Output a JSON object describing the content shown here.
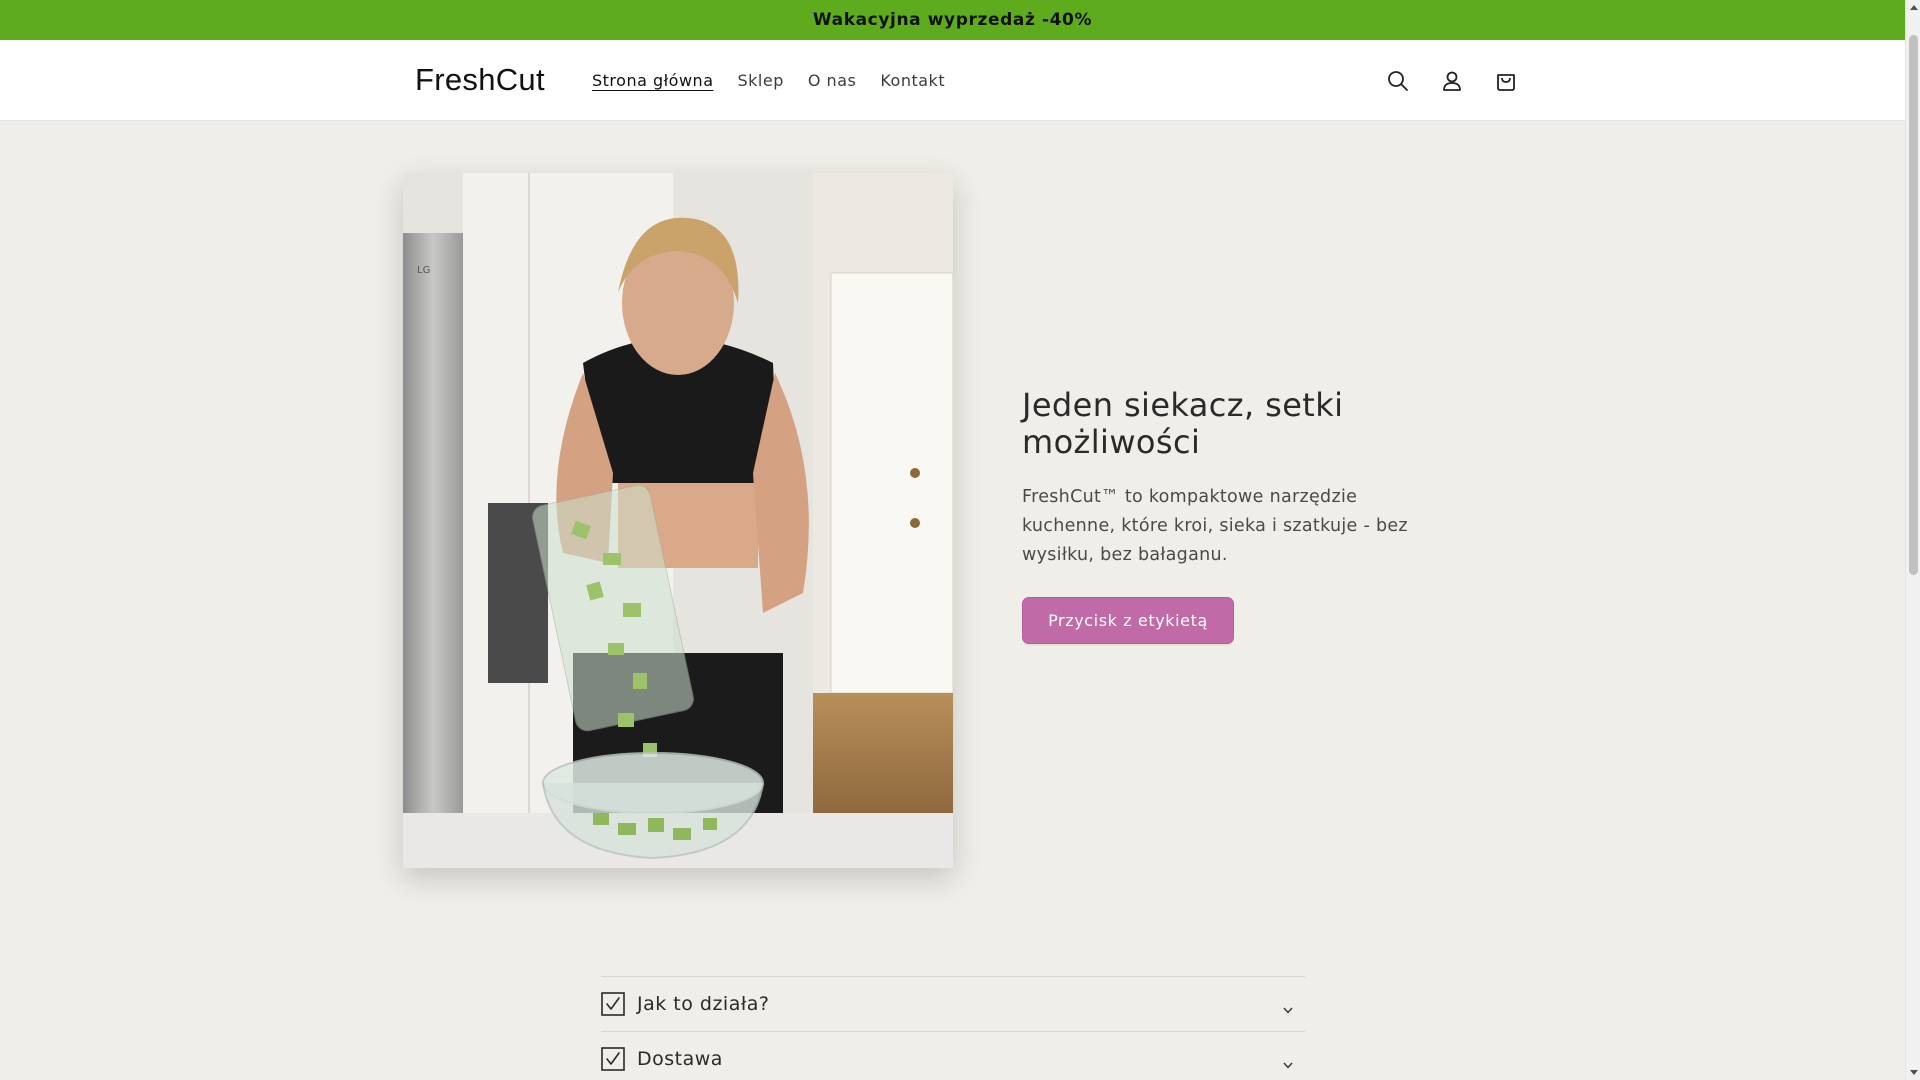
{
  "announcement": {
    "text": "Wakacyjna wyprzedaż -40%"
  },
  "header": {
    "logo": "FreshCut",
    "nav": [
      {
        "label": "Strona główna",
        "active": true
      },
      {
        "label": "Sklep",
        "active": false
      },
      {
        "label": "O nas",
        "active": false
      },
      {
        "label": "Kontakt",
        "active": false
      }
    ],
    "icons": [
      "search-icon",
      "account-icon",
      "cart-icon"
    ]
  },
  "hero": {
    "title": "Jeden siekacz, setki możliwości",
    "description": "FreshCut™ to kompaktowe narzędzie kuchenne, które kroi, sieka i szatkuje - bez wysiłku, bez bałaganu.",
    "button_label": "Przycisk z etykietą",
    "image_watermark": "LG"
  },
  "faq": {
    "items": [
      {
        "label": "Jak to działa?"
      },
      {
        "label": "Dostawa"
      }
    ]
  },
  "colors": {
    "announcement_bg": "#5eab1e",
    "page_bg": "#f0eee8",
    "button_bg": "#c06aa7"
  }
}
